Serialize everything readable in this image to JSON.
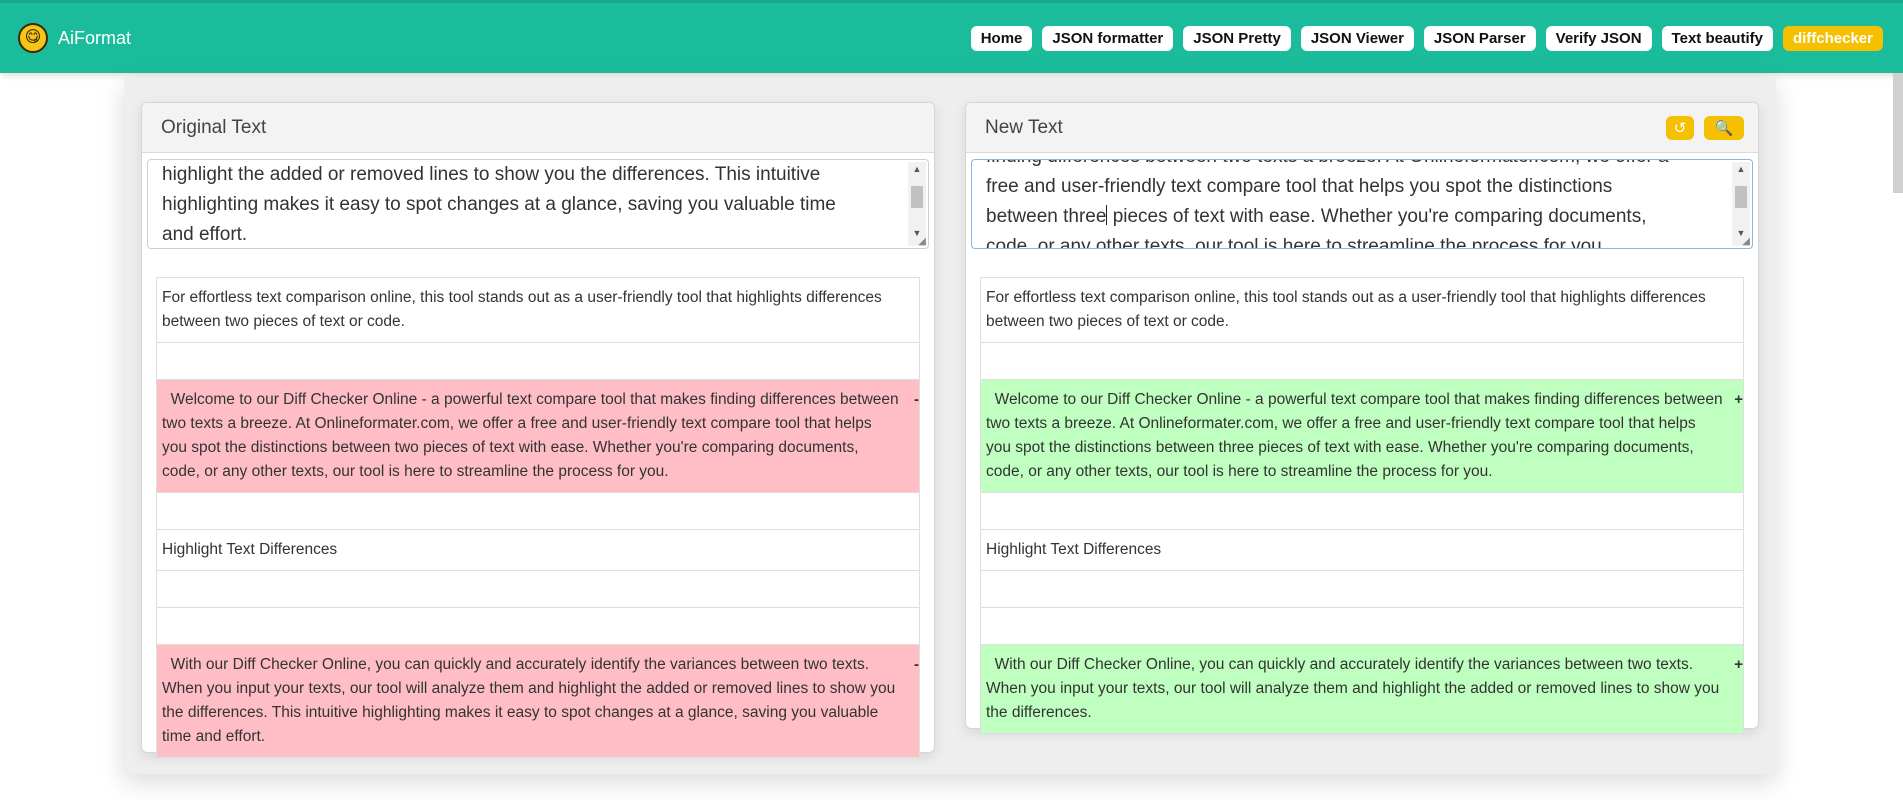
{
  "brand": {
    "name": "AiFormat",
    "logo": "😋"
  },
  "nav": [
    {
      "label": "Home",
      "active": false
    },
    {
      "label": "JSON formatter",
      "active": false
    },
    {
      "label": "JSON Pretty",
      "active": false
    },
    {
      "label": "JSON Viewer",
      "active": false
    },
    {
      "label": "JSON Parser",
      "active": false
    },
    {
      "label": "Verify JSON",
      "active": false
    },
    {
      "label": "Text beautify",
      "active": false
    },
    {
      "label": "diffchecker",
      "active": true
    }
  ],
  "left": {
    "title": "Original Text",
    "textarea_lines": [
      "highlight the added or removed lines to show you the differences. This intuitive",
      "highlighting makes it easy to spot changes at a glance, saving you valuable time",
      "and effort."
    ],
    "blocks": [
      {
        "type": "normal",
        "text": "For effortless text comparison online, this tool stands out as a user-friendly tool that highlights differences between two pieces of text or code."
      },
      {
        "type": "empty",
        "text": ""
      },
      {
        "type": "removed",
        "marker": "-",
        "text": "  Welcome to our Diff Checker Online - a powerful text compare tool that makes finding differences between two texts a breeze. At Onlineformater.com, we offer a free and user-friendly text compare tool that helps you spot the distinctions between two pieces of text with ease. Whether you're comparing documents, code, or any other texts, our tool is here to streamline the process for you."
      },
      {
        "type": "empty",
        "text": ""
      },
      {
        "type": "normal",
        "text": "Highlight Text Differences"
      },
      {
        "type": "empty",
        "text": ""
      },
      {
        "type": "empty",
        "text": ""
      },
      {
        "type": "removed",
        "marker": "-",
        "text": "  With our Diff Checker Online, you can quickly and accurately identify the variances between two texts. When you input your texts, our tool will analyze them and highlight the added or removed lines to show you the differences. This intuitive highlighting makes it easy to spot changes at a glance, saving you valuable time and effort."
      }
    ]
  },
  "right": {
    "title": "New Text",
    "tools": [
      {
        "name": "reset-icon",
        "glyph": "↺"
      },
      {
        "name": "search-icon",
        "glyph": "🔍"
      }
    ],
    "textarea_lines": [
      "finding differences between two texts a breeze. At Onlineformater.com, we offer a",
      "free and user-friendly text compare tool that helps you spot the distinctions",
      [
        "between three",
        " pieces of text with ease. Whether you're comparing documents,"
      ],
      "code, or any other texts, our tool is here to streamline the process for you."
    ],
    "blocks": [
      {
        "type": "normal",
        "text": "For effortless text comparison online, this tool stands out as a user-friendly tool that highlights differences between two pieces of text or code."
      },
      {
        "type": "empty",
        "text": ""
      },
      {
        "type": "added",
        "marker": "+",
        "text": "  Welcome to our Diff Checker Online - a powerful text compare tool that makes finding differences between two texts a breeze. At Onlineformater.com, we offer a free and user-friendly text compare tool that helps you spot the distinctions between three pieces of text with ease. Whether you're comparing documents, code, or any other texts, our tool is here to streamline the process for you."
      },
      {
        "type": "empty",
        "text": ""
      },
      {
        "type": "normal",
        "text": "Highlight Text Differences"
      },
      {
        "type": "empty",
        "text": ""
      },
      {
        "type": "empty",
        "text": ""
      },
      {
        "type": "added",
        "marker": "+",
        "text": "  With our Diff Checker Online, you can quickly and accurately identify the variances between two texts. When you input your texts, our tool will analyze them and highlight the added or removed lines to show you the differences."
      }
    ]
  },
  "colors": {
    "navbar": "#1abc9c",
    "active_nav": "#f5c000",
    "removed_bg": "#ffbec6",
    "added_bg": "#bfffbf"
  }
}
